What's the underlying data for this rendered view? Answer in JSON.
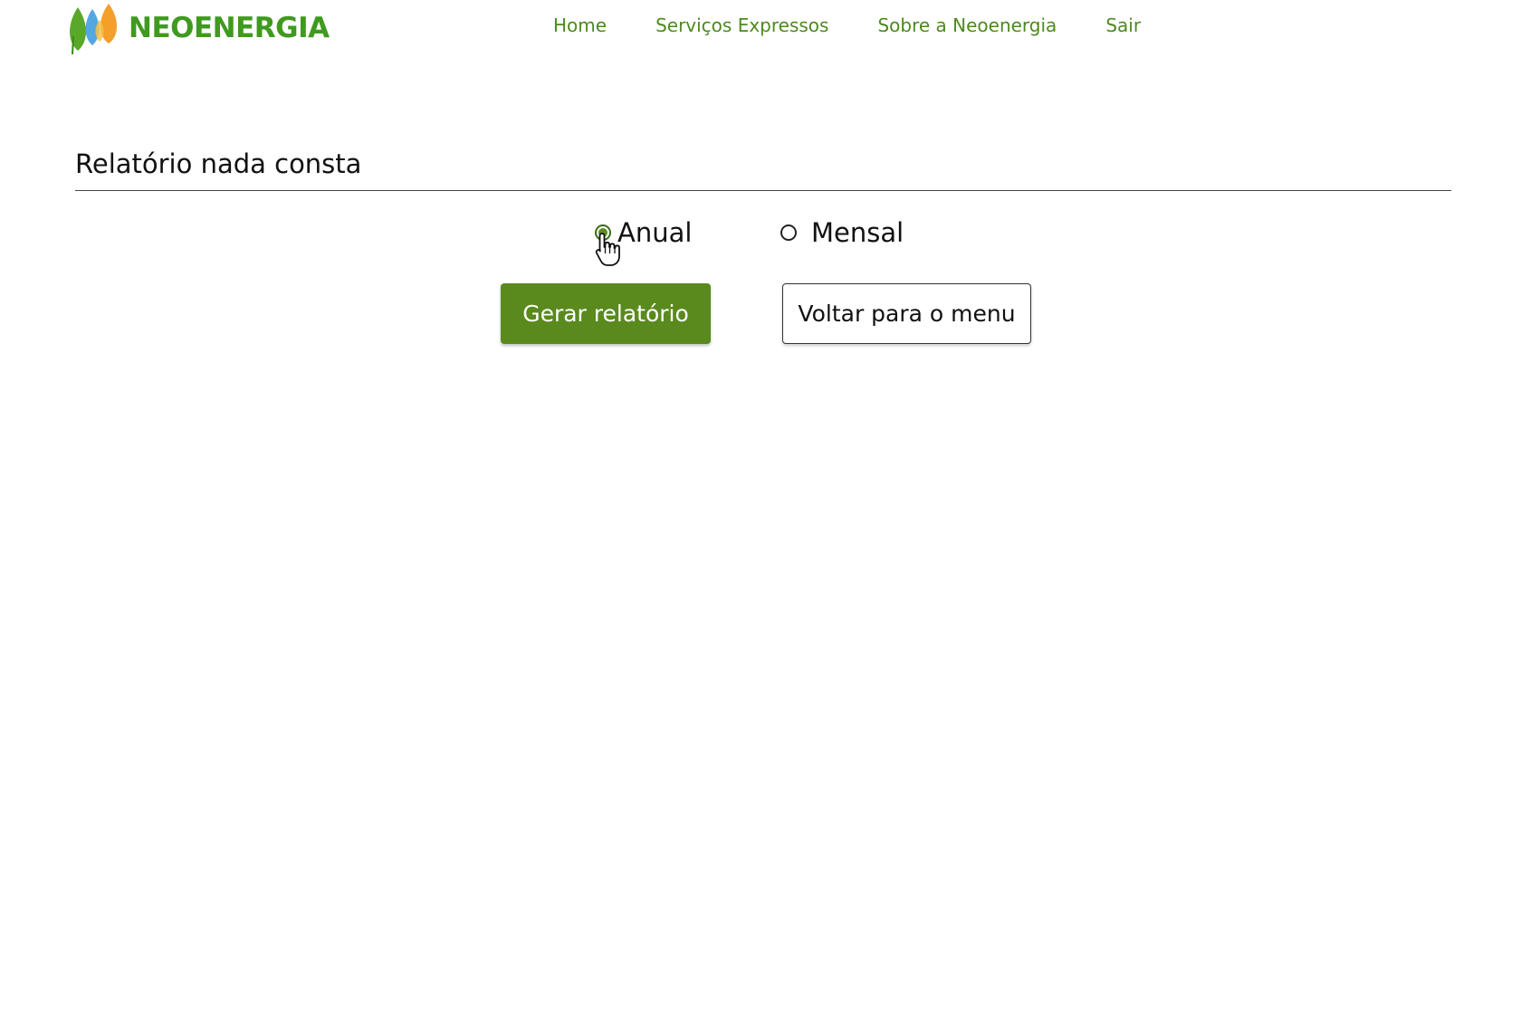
{
  "header": {
    "logo_text": "NEOENERGIA",
    "nav": [
      {
        "label": "Home"
      },
      {
        "label": "Serviços Expressos"
      },
      {
        "label": "Sobre a Neoenergia"
      },
      {
        "label": "Sair"
      }
    ]
  },
  "main": {
    "title": "Relatório nada consta",
    "options": [
      {
        "label": "Anual",
        "checked": true
      },
      {
        "label": "Mensal",
        "checked": false
      }
    ],
    "actions": {
      "generate_label": "Gerar relatório",
      "back_label": "Voltar para o menu"
    }
  },
  "colors": {
    "brand_green": "#3f9a1f",
    "nav_green": "#4d8a1e",
    "button_green": "#5a8a1e",
    "leaf_blue": "#4aa3df",
    "leaf_orange": "#f39a1e"
  },
  "icons": {
    "logo": "neoenergia-leaves-logo",
    "cursor": "hand-pointer-icon"
  }
}
